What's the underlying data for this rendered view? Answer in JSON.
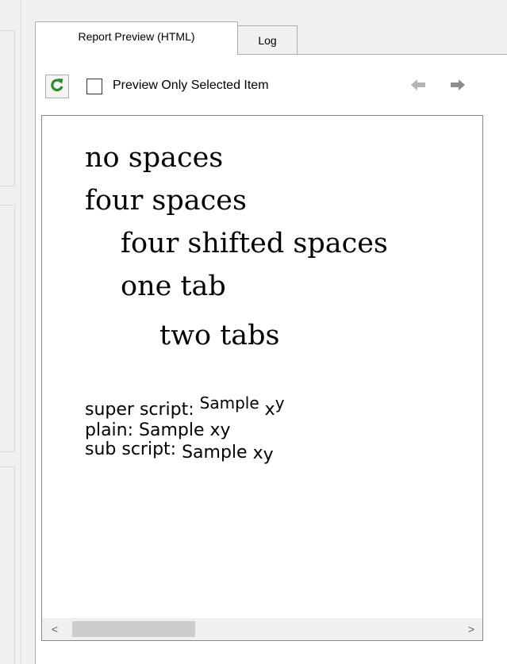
{
  "tabs": [
    {
      "label": "Report Preview (HTML)",
      "active": true
    },
    {
      "label": "Log",
      "active": false
    }
  ],
  "toolbar": {
    "refresh_icon": "refresh-icon",
    "checkbox_label": "Preview Only Selected Item",
    "checkbox_checked": false,
    "back_icon": "arrow-left-icon",
    "forward_icon": "arrow-right-icon",
    "accent_color": "#2e8b2e"
  },
  "preview": {
    "serif_lines": [
      "no spaces",
      "four spaces",
      "four shifted spaces",
      "one tab",
      "two tabs"
    ],
    "superscript_line": {
      "prefix": "super script: ",
      "sample": "Sample",
      "x": "x",
      "y": "y"
    },
    "plain_line": {
      "text": "plain: Sample xy"
    },
    "subscript_line": {
      "prefix": "sub script: ",
      "sample": "Sample",
      "x": "x",
      "y": "y"
    }
  },
  "scrollbar": {
    "left_arrow": "<",
    "right_arrow": ">"
  }
}
